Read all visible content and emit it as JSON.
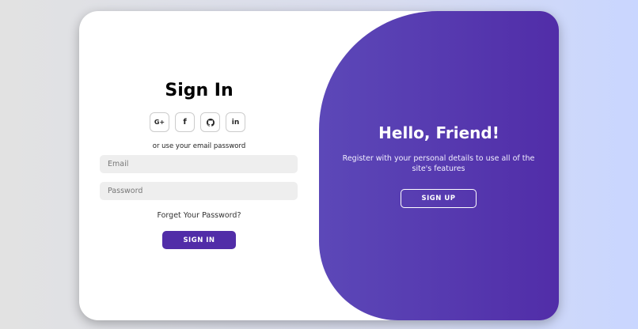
{
  "sign_in": {
    "title": "Sign In",
    "socials": [
      {
        "label": "G+",
        "icon": "google-plus-icon"
      },
      {
        "label": "f",
        "icon": "facebook-icon"
      },
      {
        "label": "",
        "icon": "github-icon"
      },
      {
        "label": "in",
        "icon": "linkedin-icon"
      }
    ],
    "divider_text": "or use your email password",
    "email_placeholder": "Email",
    "password_placeholder": "Password",
    "forgot_text": "Forget Your Password?",
    "button_label": "SIGN IN"
  },
  "toggle": {
    "title": "Hello, Friend!",
    "description": "Register with your personal details to use all of the site's features",
    "button_label": "SIGN UP"
  },
  "colors": {
    "accent": "#512da8",
    "panel_gradient_start": "#5c48b8",
    "input_bg": "#eeeeee",
    "page_bg_right": "#c9d6ff"
  }
}
